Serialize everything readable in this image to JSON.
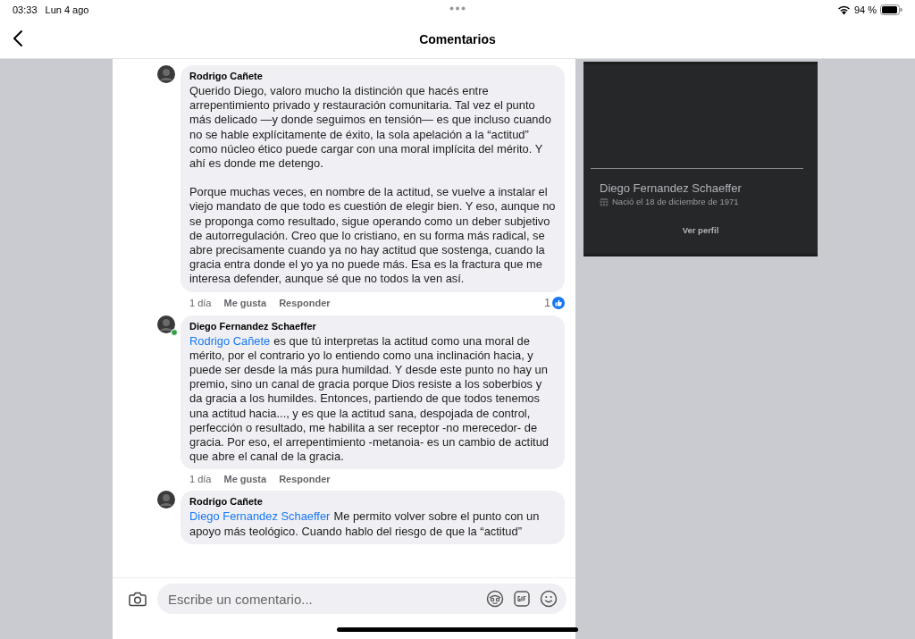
{
  "status_bar": {
    "time": "03:33",
    "date": "Lun 4 ago",
    "battery": "94 %"
  },
  "nav": {
    "title": "Comentarios"
  },
  "comments": [
    {
      "author": "Rodrigo Cañete",
      "online": false,
      "paragraphs": [
        "Querido Diego, valoro mucho la distinción que hacés entre arrepentimiento privado y restauración comunitaria. Tal vez el punto más delicado —y donde seguimos en tensión— es que incluso cuando no se hable explícitamente de éxito, la sola apelación a la “actitud” como núcleo ético puede cargar con una moral implícita del mérito. Y ahí es donde me detengo.",
        "Porque muchas veces, en nombre de la actitud, se vuelve a instalar el viejo mandato de que todo es cuestión de elegir bien. Y eso, aunque no se proponga como resultado, sigue operando como un deber subjetivo de autorregulación. Creo que lo cristiano, en su forma más radical, se abre precisamente cuando ya no hay actitud que sostenga, cuando la gracia entra donde el yo ya no puede más. Esa es la fractura que me interesa defender, aunque sé que no todos la ven así."
      ],
      "time": "1 día",
      "like": "Me gusta",
      "reply": "Responder",
      "reactions": "1"
    },
    {
      "author": "Diego Fernandez Schaeffer",
      "online": true,
      "mention": "Rodrigo Cañete",
      "paragraphs": [
        "es que tú interpretas la actitud como una moral de mérito, por el contrario yo lo entiendo como una inclinación hacia, y puede ser desde la más pura humildad. Y desde este punto no hay un premio, sino un canal de gracia porque Dios resiste a los soberbios y da gracia a los humildes. Entonces, partiendo de que todos tenemos una actitud hacia..., y es que la actitud sana, despojada de control, perfección o resultado, me habilita a ser receptor -no merecedor- de gracia. Por eso, el arrepentimiento -metanoia- es un cambio de actitud que abre el canal de la gracia."
      ],
      "time": "1 día",
      "like": "Me gusta",
      "reply": "Responder"
    },
    {
      "author": "Rodrigo Cañete",
      "online": false,
      "mention": "Diego Fernandez Schaeffer",
      "paragraphs": [
        "Me permito volver sobre el punto con un apoyo más teológico. Cuando hablo del riesgo de que la “actitud”"
      ]
    }
  ],
  "profile_card": {
    "name": "Diego Fernandez Schaeffer",
    "birthday": "Nació el 18 de diciembre de 1971",
    "button": "Ver perfil"
  },
  "composer": {
    "placeholder": "Escribe un comentario..."
  }
}
